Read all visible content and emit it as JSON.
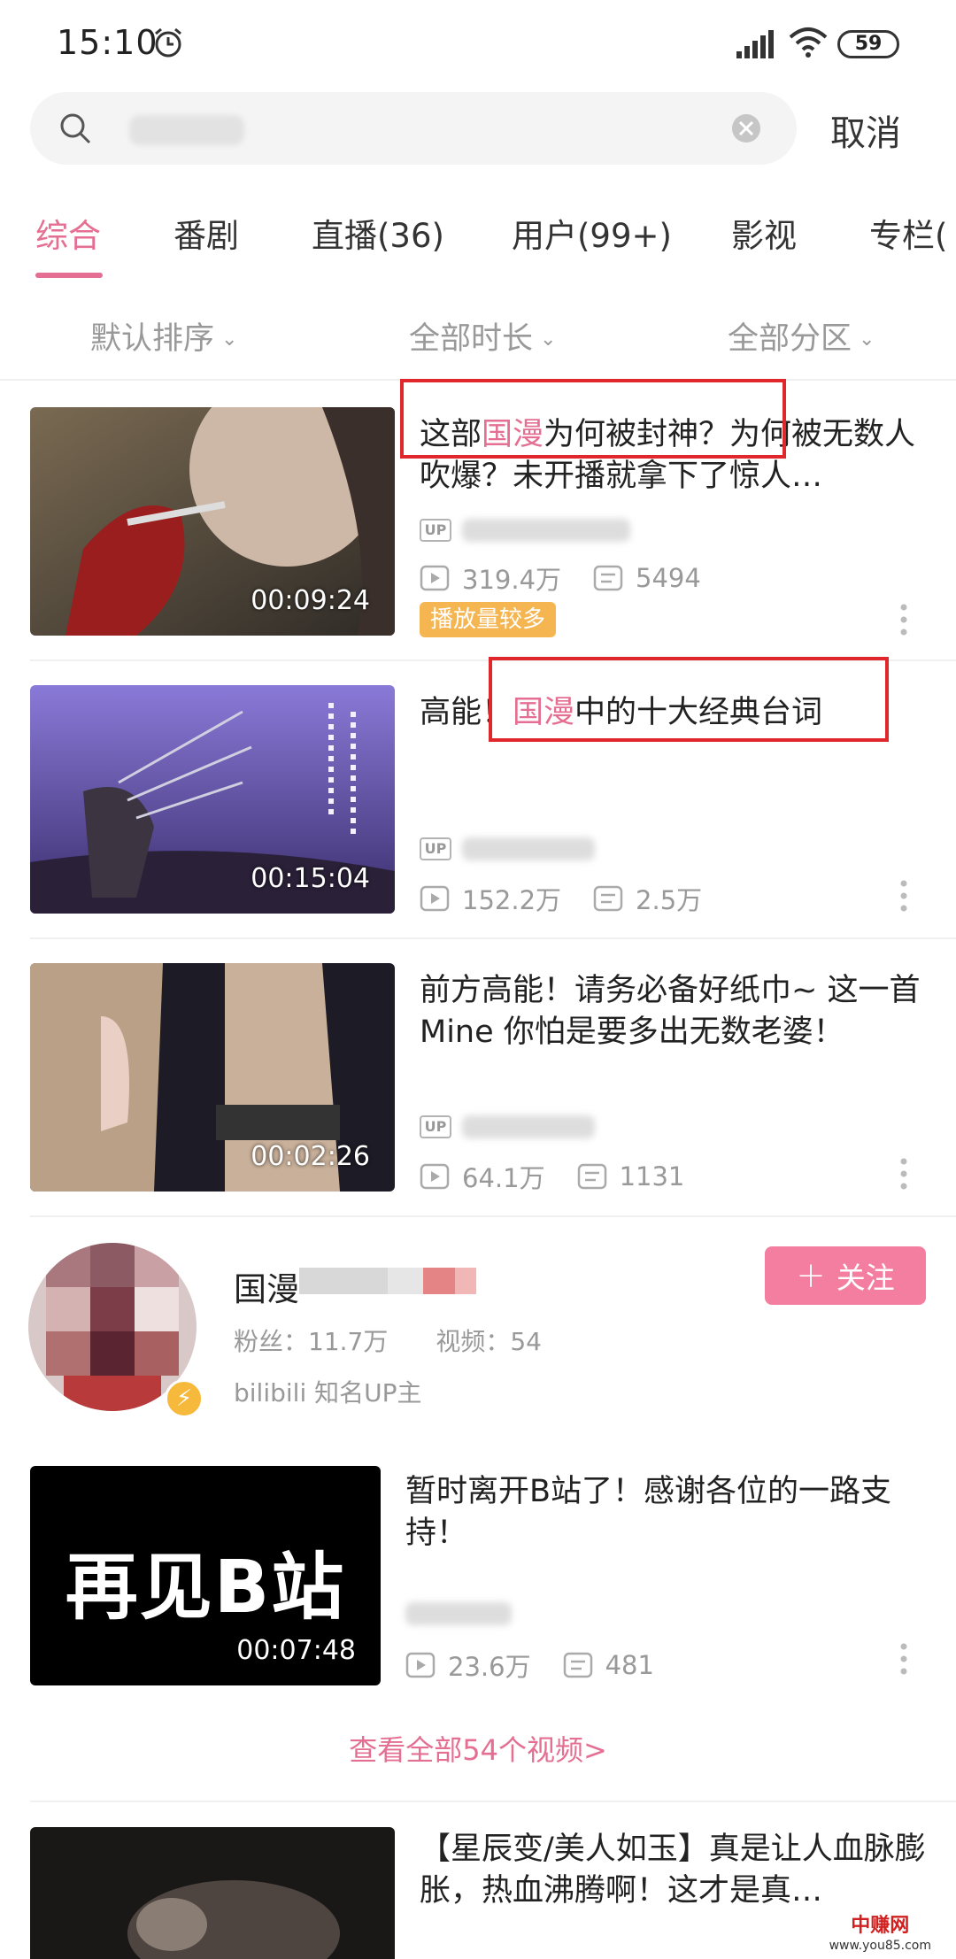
{
  "status_bar": {
    "time": "15:10",
    "battery": "59"
  },
  "search": {
    "cancel_label": "取消"
  },
  "tabs": [
    {
      "label": "综合",
      "active": true
    },
    {
      "label": "番剧"
    },
    {
      "label": "直播(36)"
    },
    {
      "label": "用户(99+)"
    },
    {
      "label": "影视"
    },
    {
      "label": "专栏("
    }
  ],
  "filters": [
    {
      "label": "默认排序"
    },
    {
      "label": "全部时长"
    },
    {
      "label": "全部分区"
    }
  ],
  "videos": [
    {
      "title_pre": "这部",
      "title_hl": "国漫",
      "title_post": "为何被封神？为何被无数人吹爆？未开播就拿下了惊人…",
      "duration": "00:09:24",
      "views": "319.4万",
      "danmaku": "5494",
      "badge": "播放量较多"
    },
    {
      "title_pre": "高能！",
      "title_hl": "国漫",
      "title_post": "中的十大经典台词",
      "duration": "00:15:04",
      "views": "152.2万",
      "danmaku": "2.5万"
    },
    {
      "title_pre": "前方高能！请务必备好纸巾~ 这一首Mine 你怕是要多出无数老婆！",
      "title_hl": "",
      "title_post": "",
      "duration": "00:02:26",
      "views": "64.1万",
      "danmaku": "1131"
    }
  ],
  "user_card": {
    "name": "国漫",
    "fans": "粉丝：11.7万",
    "videos": "视频：54",
    "desc": "bilibili 知名UP主",
    "follow_label": "关注"
  },
  "user_video": {
    "thumb_text": "再见B站",
    "title": "暂时离开B站了！感谢各位的一路支持！",
    "duration": "00:07:48",
    "views": "23.6万",
    "danmaku": "481"
  },
  "view_all_label": "查看全部54个视频>",
  "last_video": {
    "title": "【星辰变/美人如玉】真是让人血脉膨胀，热血沸腾啊！这才是真…"
  },
  "watermark": {
    "line1": "中赚网",
    "line2": "www.you85.com"
  },
  "colors": {
    "accent": "#e46f92",
    "badge": "#f5b550",
    "follow": "#f47ea0",
    "annotation": "#e0272b"
  }
}
